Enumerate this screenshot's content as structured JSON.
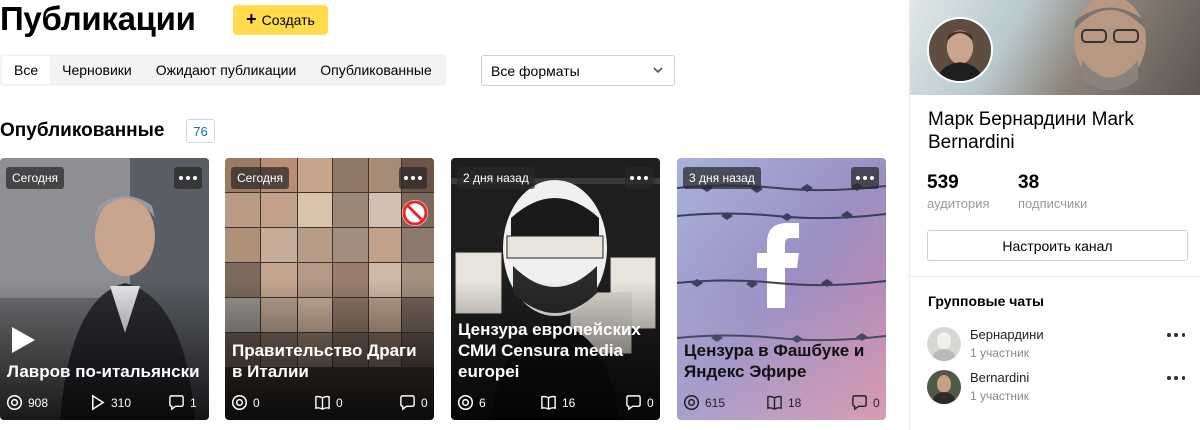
{
  "header": {
    "title": "Публикации",
    "create_label": "Создать"
  },
  "tabs": [
    {
      "label": "Все",
      "active": true
    },
    {
      "label": "Черновики",
      "active": false
    },
    {
      "label": "Ожидают публикации",
      "active": false
    },
    {
      "label": "Опубликованные",
      "active": false
    }
  ],
  "format_filter": {
    "selected": "Все форматы"
  },
  "section": {
    "title": "Опубликованные",
    "count": "76"
  },
  "cards": [
    {
      "date": "Сегодня",
      "title": "Лавров по-итальянски",
      "stats": {
        "views": "908",
        "plays": "310",
        "comments": "1"
      }
    },
    {
      "date": "Сегодня",
      "title": "Правительство Драги в Италии",
      "stats": {
        "views": "0",
        "reads": "0",
        "comments": "0"
      }
    },
    {
      "date": "2 дня назад",
      "title": "Цензура европейских СМИ Censura media europei",
      "stats": {
        "views": "6",
        "reads": "16",
        "comments": "0"
      }
    },
    {
      "date": "3 дня назад",
      "title": "Цензура в Фашбуке и Яндекс Эфире",
      "stats": {
        "views": "615",
        "reads": "18",
        "comments": "0"
      }
    }
  ],
  "channel": {
    "name": "Марк Бернардини Mark Bernardini",
    "audience": "539",
    "audience_label": "аудитория",
    "subscribers": "38",
    "subscribers_label": "подписчики",
    "config_label": "Настроить канал"
  },
  "group_chats": {
    "title": "Групповые чаты",
    "items": [
      {
        "name": "Бернардини",
        "members": "1 участник"
      },
      {
        "name": "Bernardini",
        "members": "1 участник"
      }
    ]
  },
  "colors": {
    "accent_yellow": "#ffdb4d",
    "badge_blue": "#1a6fb5"
  }
}
